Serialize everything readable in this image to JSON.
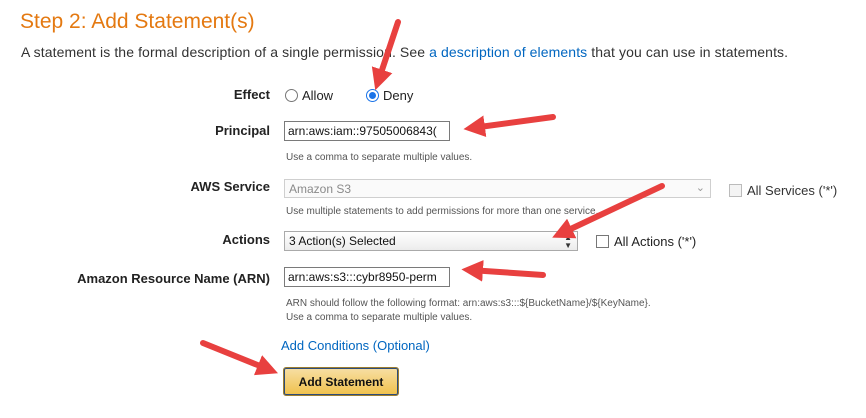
{
  "header": {
    "step_title": "Step 2: Add Statement(s)",
    "intro_before": "A statement is the formal description of a single permission. See ",
    "intro_link": "a description of elements",
    "intro_after": " that you can use in statements."
  },
  "form": {
    "effect": {
      "label": "Effect",
      "options": [
        "Allow",
        "Deny"
      ],
      "selected": "Deny"
    },
    "principal": {
      "label": "Principal",
      "value": "arn:aws:iam::97505006843(",
      "hint": "Use a comma to separate multiple values."
    },
    "aws_service": {
      "label": "AWS Service",
      "value": "Amazon S3",
      "hint": "Use multiple statements to add permissions for more than one service.",
      "all_services_label": "All Services ('*')"
    },
    "actions": {
      "label": "Actions",
      "value": "3 Action(s) Selected",
      "all_actions_label": "All Actions ('*')"
    },
    "arn": {
      "label": "Amazon Resource Name (ARN)",
      "value": "arn:aws:s3:::cybr8950-perm",
      "hint_line1": "ARN should follow the following format: arn:aws:s3:::${BucketName}/${KeyName}.",
      "hint_line2": "Use a comma to separate multiple values."
    },
    "add_conditions_label": "Add Conditions (Optional)",
    "add_statement_label": "Add Statement"
  },
  "colors": {
    "title_orange": "#e47911",
    "link_blue": "#0066c0",
    "button_gold": "#f0c14b",
    "annotation_arrow": "#e8403f"
  }
}
